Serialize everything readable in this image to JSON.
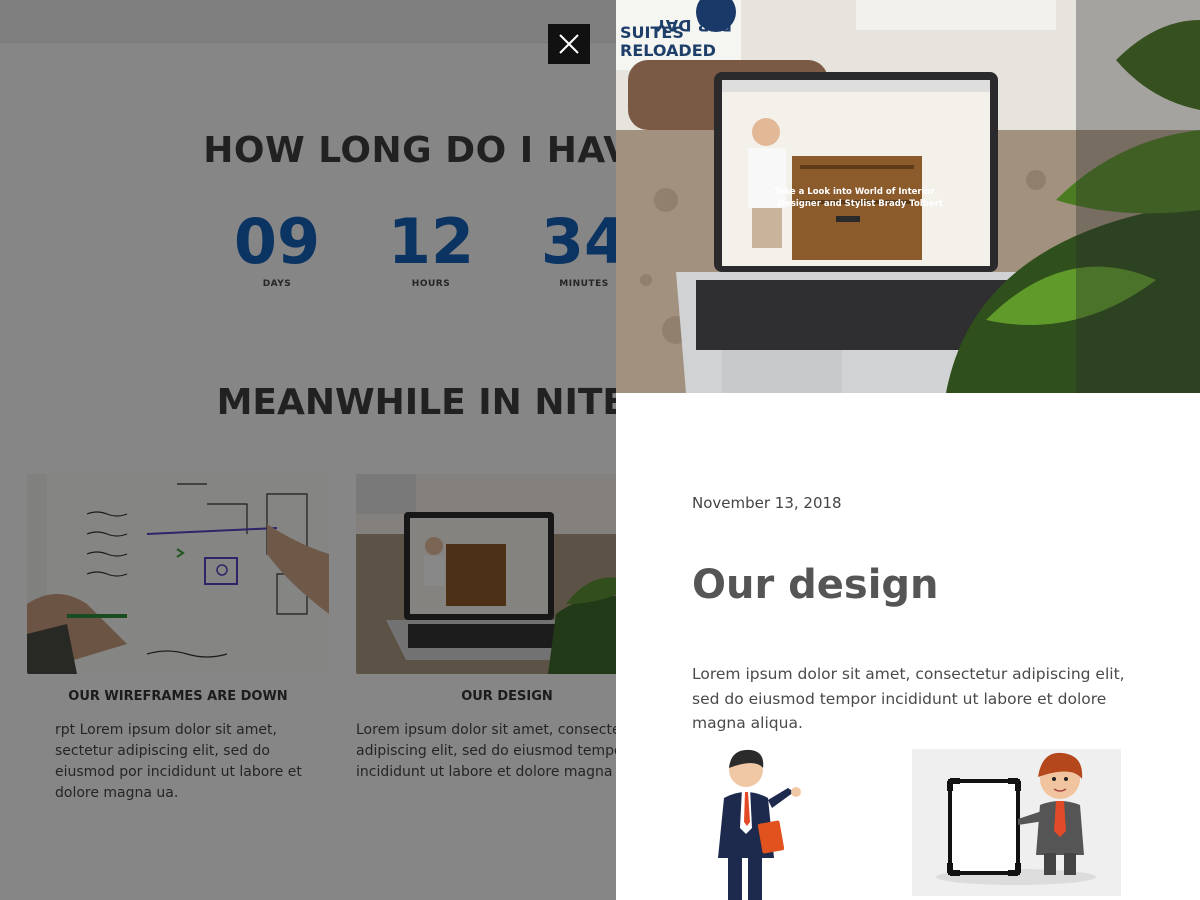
{
  "countdown": {
    "title": "HOW LONG DO I HAVE",
    "items": [
      {
        "value": "09",
        "label": "DAYS"
      },
      {
        "value": "12",
        "label": "HOURS"
      },
      {
        "value": "34",
        "label": "MINUTES"
      }
    ]
  },
  "section": {
    "title": "MEANWHILE IN NITEC",
    "cards": [
      {
        "title": "OUR WIREFRAMES ARE DOWN",
        "excerpt": "rpt Lorem ipsum dolor sit amet, sectetur adipiscing elit, sed do eiusmod por incididunt ut labore et dolore magna ua."
      },
      {
        "title": "OUR DESIGN",
        "excerpt": "Lorem ipsum dolor sit amet, consectetur adipiscing elit, sed do eiusmod tempor incididunt ut labore et dolore magna It ..."
      }
    ]
  },
  "modal": {
    "close_icon": "close-icon",
    "hero_laptop_text": "Take a Look into World of Interior Designer and Stylist Brady Tolbert",
    "hero_sign_text": "PER DAY SUITES RELOADED",
    "date": "November 13, 2018",
    "title": "Our design",
    "body": "Lorem ipsum dolor sit amet, consectetur adipiscing elit, sed do eiusmod tempor incididunt ut labore et dolore magna aliqua."
  },
  "colors": {
    "accent": "#1660b4",
    "overlay": "rgba(0,0,0,0.45)",
    "close_bg": "#111111"
  }
}
